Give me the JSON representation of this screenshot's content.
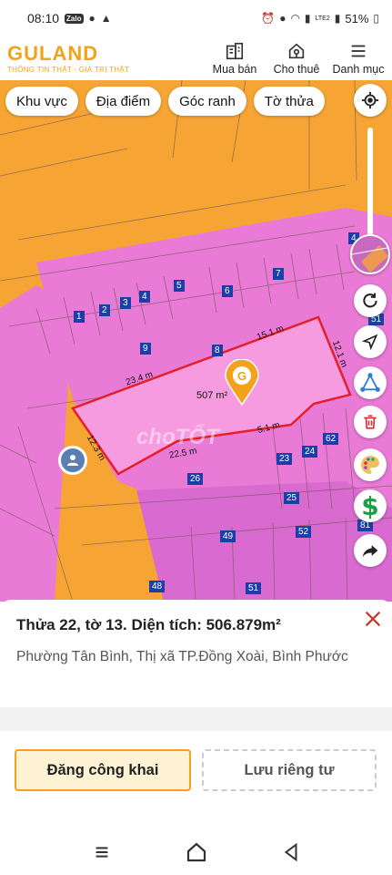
{
  "status_bar": {
    "time": "08:10",
    "battery": "51%",
    "net_label": "LTE2"
  },
  "header": {
    "logo_text": "GULAND",
    "logo_tagline": "THÔNG TIN THẬT - GIÁ TRỊ THẬT",
    "nav": [
      {
        "label": "Mua bán",
        "icon": "building-icon"
      },
      {
        "label": "Cho thuê",
        "icon": "house-key-icon"
      },
      {
        "label": "Danh mục",
        "icon": "menu-icon"
      }
    ]
  },
  "filters": [
    "Khu vực",
    "Địa điểm",
    "Góc ranh",
    "Tờ thửa"
  ],
  "map": {
    "area_label": "507 m²",
    "watermark": "choTỐT",
    "dimensions": [
      "15.1 m",
      "12.1 m",
      "23.4 m",
      "12.3 m",
      "22.5 m",
      "5.1 m"
    ],
    "parcel_numbers": [
      "1",
      "2",
      "3",
      "4",
      "5",
      "6",
      "7",
      "8",
      "9",
      "23",
      "24",
      "25",
      "26",
      "48",
      "49",
      "51",
      "52",
      "62",
      "81",
      "4",
      "51"
    ]
  },
  "parcel": {
    "title": "Thửa 22, tờ 13. Diện tích: 506.879m²",
    "address": "Phường Tân Bình, Thị xã TP.Đồng Xoài, Bình Phước"
  },
  "actions": {
    "public_label": "Đăng công khai",
    "private_label": "Lưu riêng tư"
  },
  "colors": {
    "accent": "#f2a31b",
    "map_orange": "#f6a534",
    "map_pink": "#e97ad6",
    "parcel_highlight": "#f79be0",
    "boundary_red": "#e3202a"
  }
}
